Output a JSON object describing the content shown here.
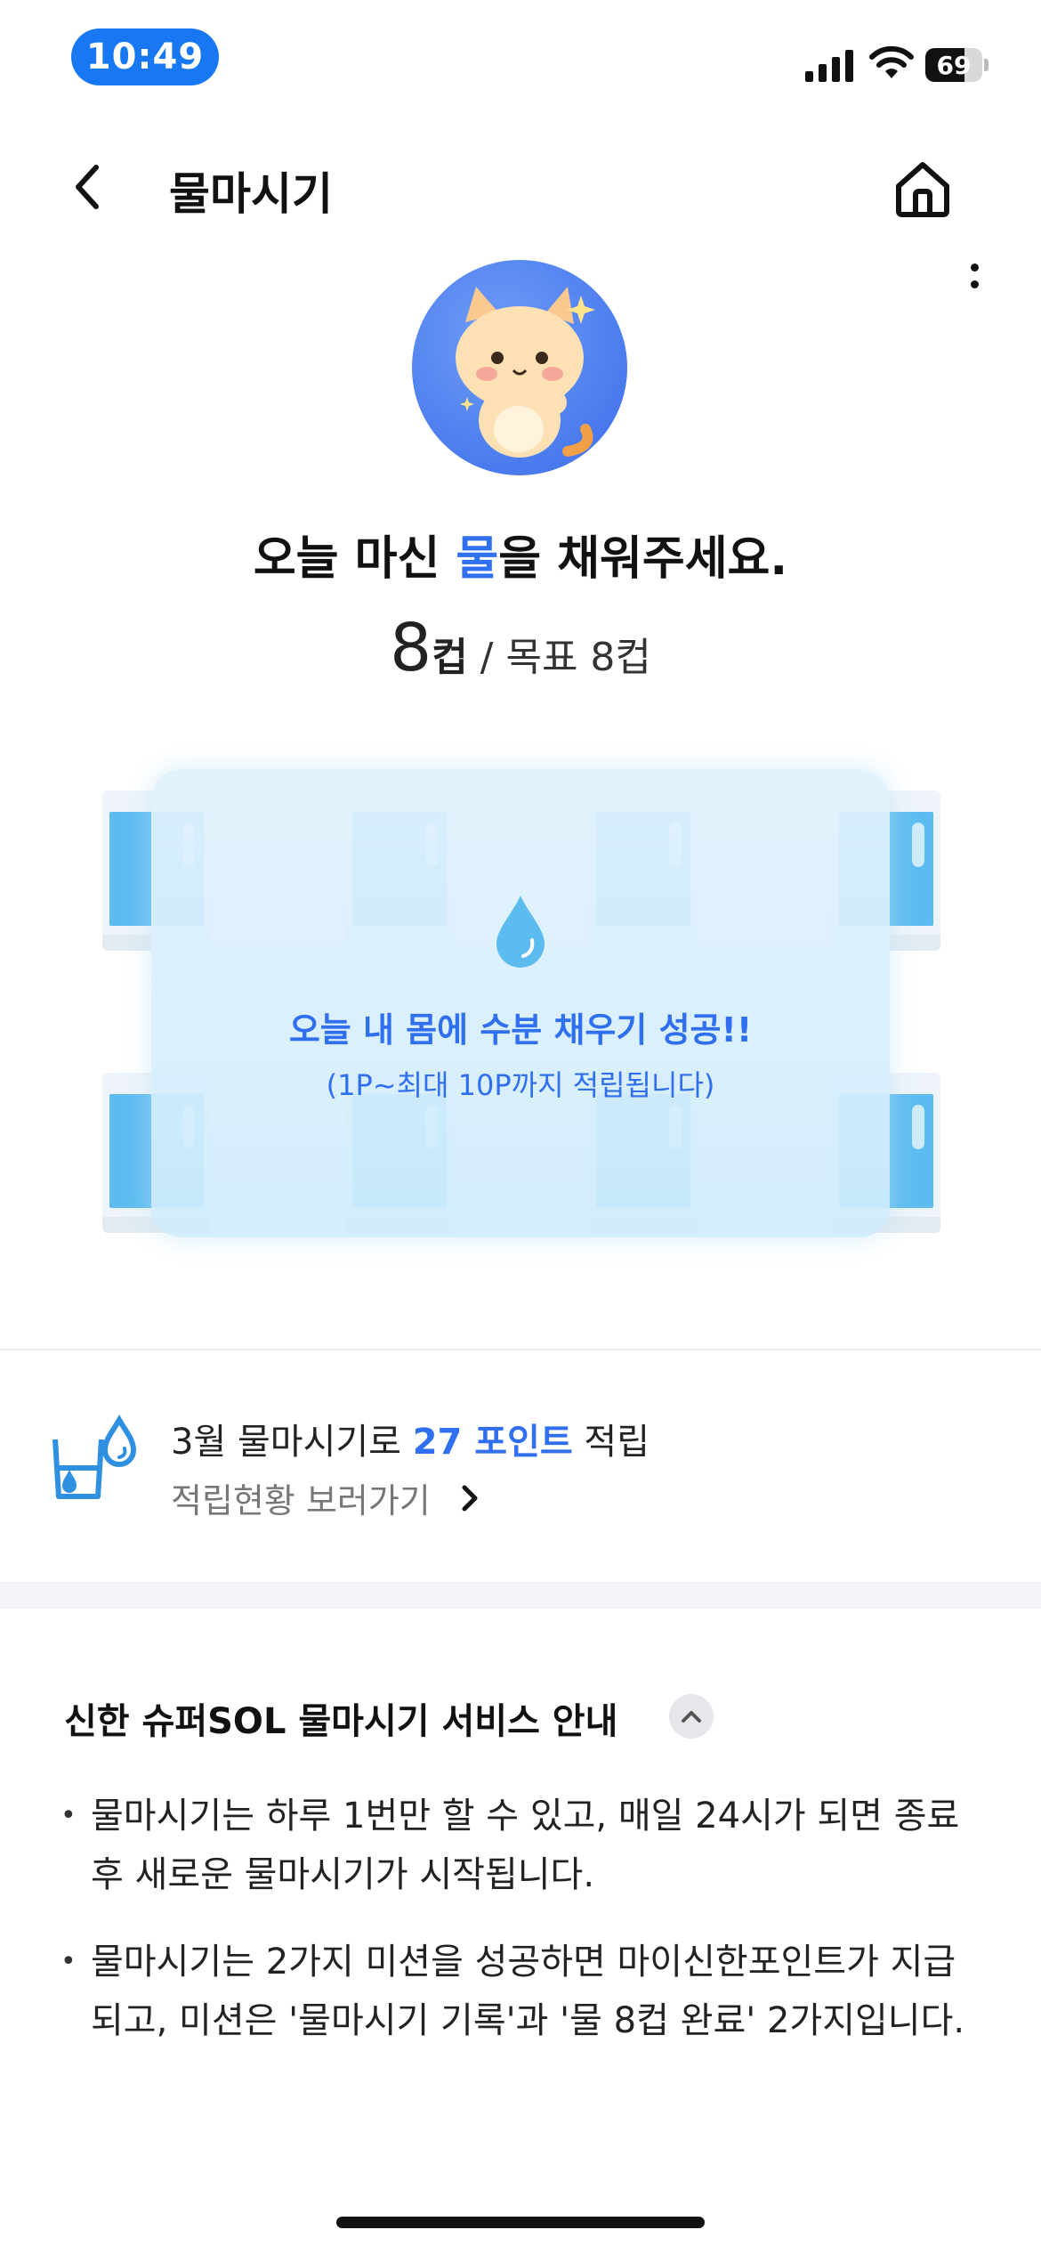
{
  "status_bar": {
    "time": "10:49",
    "battery": "69",
    "battery_level": 0.69
  },
  "header": {
    "title": "물마시기"
  },
  "main": {
    "headline_pre": "오늘 마신 ",
    "headline_accent": "물",
    "headline_post": "을 채워주세요.",
    "count": "8",
    "count_unit": "컵",
    "goal_text": " / 목표 8컵"
  },
  "cups": {
    "success_message": "오늘 내 몸에 수분 채우기 성공!!",
    "success_sub": "(1P~최대 10P까지 적립됩니다)"
  },
  "points": {
    "text_pre": "3월 물마시기로 ",
    "text_accent": "27 포인트",
    "text_post": " 적립",
    "link_label": "적립현황 보러가기"
  },
  "info": {
    "title": "신한 슈퍼SOL 물마시기 서비스 안내",
    "bullets": [
      "물마시기는 하루 1번만 할 수 있고, 매일 24시가 되면 종료 후 새로운 물마시기가 시작됩니다.",
      "물마시기는 2가지 미션을 성공하면 마이신한포인트가 지급되고, 미션은 '물마시기 기록'과 '물 8컵 완료' 2가지입니다."
    ]
  },
  "colors": {
    "accent": "#2f6ff0",
    "time_pill": "#1877f2",
    "water": "#5cbcf0"
  }
}
